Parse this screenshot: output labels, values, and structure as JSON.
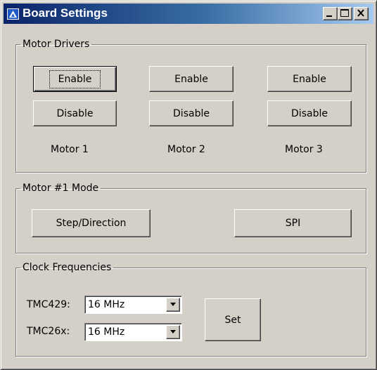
{
  "window": {
    "title": "Board Settings",
    "icons": {
      "app": "app-triangle-icon",
      "minimize": "minimize-icon",
      "maximize": "maximize-icon",
      "close": "close-icon"
    }
  },
  "motor_drivers": {
    "legend": "Motor Drivers",
    "motors": [
      {
        "enable_label": "Enable",
        "disable_label": "Disable",
        "name": "Motor 1"
      },
      {
        "enable_label": "Enable",
        "disable_label": "Disable",
        "name": "Motor 2"
      },
      {
        "enable_label": "Enable",
        "disable_label": "Disable",
        "name": "Motor 3"
      }
    ]
  },
  "motor1_mode": {
    "legend": "Motor #1 Mode",
    "step_direction_label": "Step/Direction",
    "spi_label": "SPI"
  },
  "clock_frequencies": {
    "legend": "Clock Frequencies",
    "tmc429": {
      "label": "TMC429:",
      "value": "16 MHz"
    },
    "tmc26x": {
      "label": "TMC26x:",
      "value": "16 MHz"
    },
    "set_label": "Set"
  },
  "colors": {
    "face": "#d4d0c8",
    "title_start": "#0a246a",
    "title_end": "#a6caf0"
  }
}
